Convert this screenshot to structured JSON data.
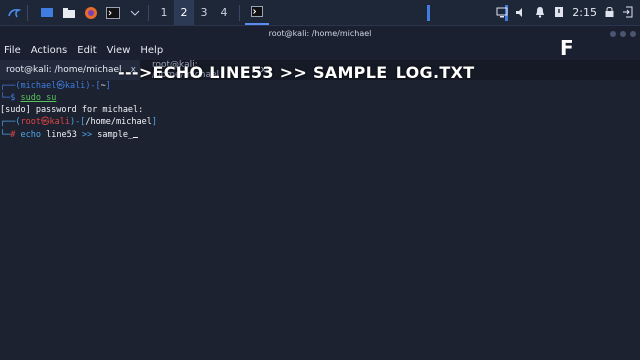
{
  "panel": {
    "workspaces": [
      "1",
      "2",
      "3",
      "4"
    ],
    "active_workspace": "2",
    "clock": "2:15",
    "icons": [
      "kali-menu-icon",
      "desktop-icon",
      "files-icon",
      "firefox-icon",
      "terminal-icon",
      "chevron-down-icon"
    ],
    "tray_icons": [
      "monitor-icon",
      "speaker-icon",
      "bell-icon",
      "power-icon",
      "lock-icon",
      "logout-icon"
    ]
  },
  "window": {
    "title": "root@kali: /home/michael",
    "menu": [
      "File",
      "Actions",
      "Edit",
      "View",
      "Help"
    ],
    "tabs": [
      {
        "label": "root@kali: /home/michael",
        "close": "x"
      },
      {
        "label": "root@kali: /home/michael",
        "close": "x"
      }
    ]
  },
  "overlay": {
    "caption": "--->ECHO LINE53  >> SAMPLE_LOG.TXT",
    "corner_letter": "F"
  },
  "terminal": {
    "l1": {
      "a": "┌──(",
      "user": "michael",
      "skull": "㉿",
      "host": "kali",
      "b": ")-[",
      "path": "~",
      "c": "]"
    },
    "l2": {
      "a": "└─",
      "prompt": "$ ",
      "cmd": "sudo su"
    },
    "l3": {
      "text": "[sudo] password for michael:"
    },
    "l4": {
      "a": "┌──(",
      "user": "root",
      "skull": "㉿",
      "host": "kali",
      "b": ")-[",
      "path": "/home/michael",
      "c": "]"
    },
    "l5": {
      "a": "└─",
      "prompt": "# ",
      "cmd": "echo",
      "rest1": " line53 ",
      "op": ">>",
      "rest2": " sample_"
    }
  }
}
